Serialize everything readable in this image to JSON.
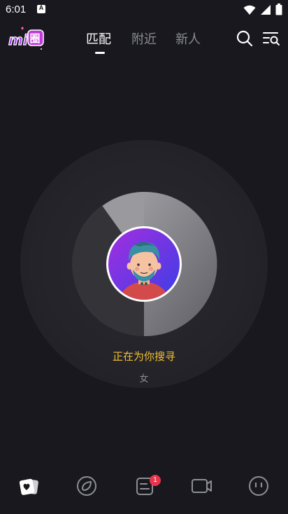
{
  "status_bar": {
    "time": "6:01",
    "notification_letter": "A"
  },
  "header": {
    "logo_text": "mi圈",
    "tabs": [
      {
        "label": "匹配",
        "active": true
      },
      {
        "label": "附近",
        "active": false
      },
      {
        "label": "新人",
        "active": false
      }
    ]
  },
  "match": {
    "searching_text": "正在为你搜寻",
    "gender": "女",
    "accent_color": "#f2c033"
  },
  "bottom_nav": {
    "items": [
      {
        "icon": "cards-icon",
        "active": true
      },
      {
        "icon": "compass-icon",
        "active": false
      },
      {
        "icon": "messages-icon",
        "active": false,
        "badge": "1"
      },
      {
        "icon": "video-icon",
        "active": false
      },
      {
        "icon": "face-icon",
        "active": false
      }
    ],
    "badge_color": "#e8344d"
  }
}
